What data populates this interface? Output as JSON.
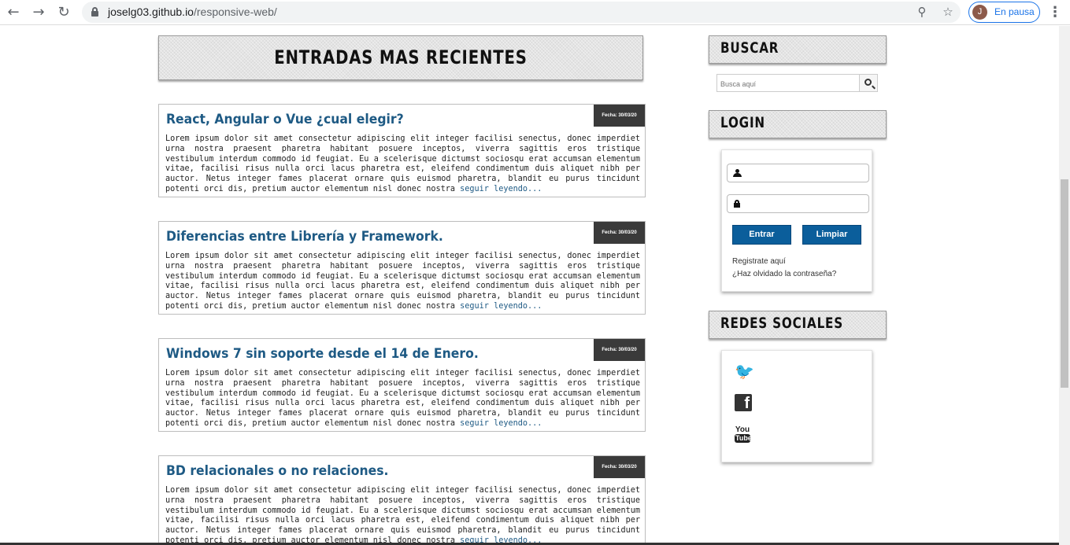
{
  "browser": {
    "url_domain": "joselg03.github.io",
    "url_path": "/responsive-web/",
    "profile_initial": "J",
    "profile_status": "En pausa",
    "icons": [
      "back-icon",
      "forward-icon",
      "reload-icon",
      "lock-icon",
      "zoom-icon",
      "star-icon",
      "menu-icon"
    ]
  },
  "main": {
    "section_title": "ENTRADAS MAS RECIENTES",
    "posts": [
      {
        "title": "React, Angular o Vue ¿cual elegir?",
        "date": "Fecha: 30/03/20",
        "text": "Lorem ipsum dolor sit amet consectetur adipiscing elit integer facilisi senectus, donec imperdiet urna nostra praesent pharetra habitant posuere inceptos, viverra sagittis eros tristique vestibulum interdum commodo id feugiat. Eu a scelerisque dictumst sociosqu erat accumsan elementum vitae, facilisi risus nulla orci lacus pharetra est, eleifend condimentum duis aliquet nibh per auctor. Netus integer fames placerat ornare quis euismod pharetra, blandit eu purus tincidunt potenti orci dis, pretium auctor elementum nisl donec nostra ",
        "more": "seguir leyendo..."
      },
      {
        "title": "Diferencias entre Librería y Framework.",
        "date": "Fecha: 30/03/20",
        "text": "Lorem ipsum dolor sit amet consectetur adipiscing elit integer facilisi senectus, donec imperdiet urna nostra praesent pharetra habitant posuere inceptos, viverra sagittis eros tristique vestibulum interdum commodo id feugiat. Eu a scelerisque dictumst sociosqu erat accumsan elementum vitae, facilisi risus nulla orci lacus pharetra est, eleifend condimentum duis aliquet nibh per auctor. Netus integer fames placerat ornare quis euismod pharetra, blandit eu purus tincidunt potenti orci dis, pretium auctor elementum nisl donec nostra ",
        "more": "seguir leyendo..."
      },
      {
        "title": "Windows 7 sin soporte desde el 14 de Enero.",
        "date": "Fecha: 30/03/20",
        "text": "Lorem ipsum dolor sit amet consectetur adipiscing elit integer facilisi senectus, donec imperdiet urna nostra praesent pharetra habitant posuere inceptos, viverra sagittis eros tristique vestibulum interdum commodo id feugiat. Eu a scelerisque dictumst sociosqu erat accumsan elementum vitae, facilisi risus nulla orci lacus pharetra est, eleifend condimentum duis aliquet nibh per auctor. Netus integer fames placerat ornare quis euismod pharetra, blandit eu purus tincidunt potenti orci dis, pretium auctor elementum nisl donec nostra ",
        "more": "seguir leyendo..."
      },
      {
        "title": "BD relacionales o no relaciones.",
        "date": "Fecha: 30/03/20",
        "text": "Lorem ipsum dolor sit amet consectetur adipiscing elit integer facilisi senectus, donec imperdiet urna nostra praesent pharetra habitant posuere inceptos, viverra sagittis eros tristique vestibulum interdum commodo id feugiat. Eu a scelerisque dictumst sociosqu erat accumsan elementum vitae, facilisi risus nulla orci lacus pharetra est, eleifend condimentum duis aliquet nibh per auctor. Netus integer fames placerat ornare quis euismod pharetra, blandit eu purus tincidunt potenti orci dis, pretium auctor elementum nisl donec nostra ",
        "more": "seguir leyendo..."
      }
    ]
  },
  "sidebar": {
    "search": {
      "heading": "BUSCAR",
      "placeholder": "Busca aquí"
    },
    "login": {
      "heading": "LOGIN",
      "submit_label": "Entrar",
      "clear_label": "Limpiar",
      "register_link": "Registrate aquí",
      "forgot_link": "¿Haz olvidado la contraseña?"
    },
    "social": {
      "heading": "REDES SOCIALES",
      "icons": [
        "twitter-icon",
        "facebook-icon",
        "youtube-icon"
      ],
      "youtube_top": "You",
      "youtube_bottom": "Tube"
    }
  }
}
